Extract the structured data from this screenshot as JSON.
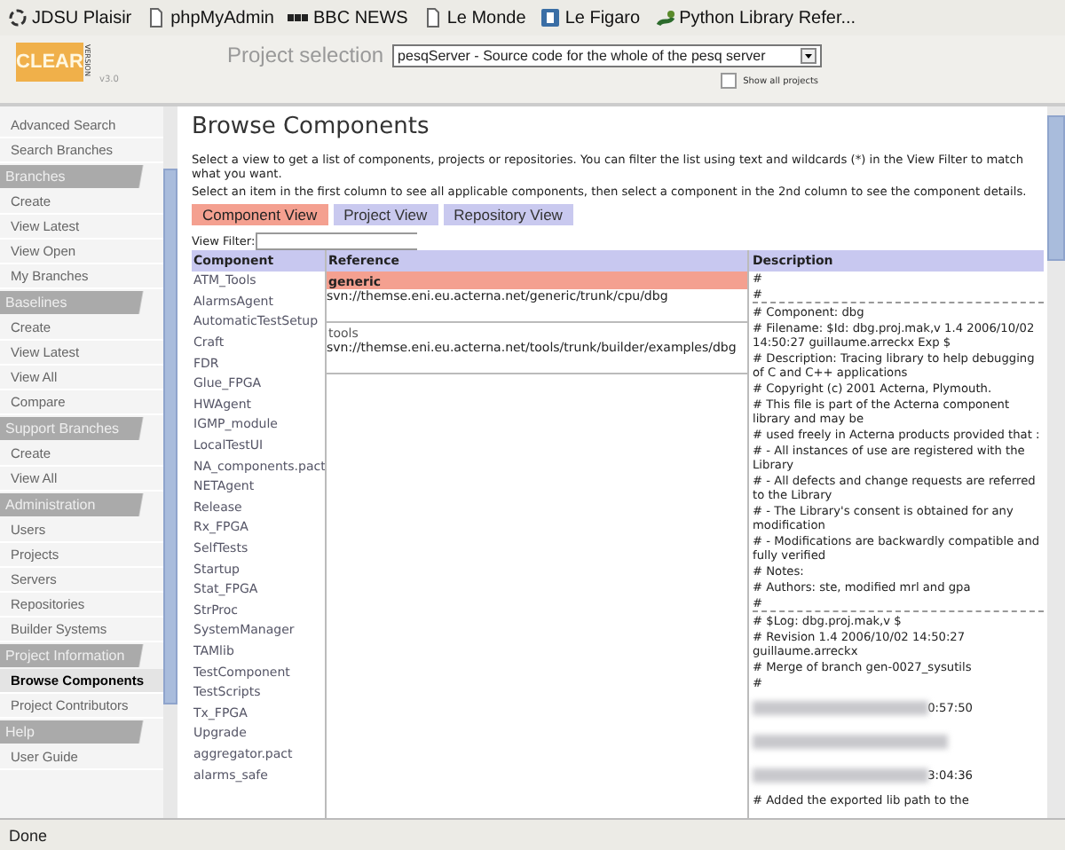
{
  "bookmarks": [
    {
      "label": "JDSU Plaisir"
    },
    {
      "label": "phpMyAdmin"
    },
    {
      "label": "BBC NEWS"
    },
    {
      "label": "Le Monde"
    },
    {
      "label": "Le Figaro"
    },
    {
      "label": "Python Library Refer..."
    }
  ],
  "header": {
    "logo": "CLEAR",
    "logo_side": "VERSION",
    "version": "v3.0",
    "project_label": "Project selection",
    "project_value": "pesqServer - Source code for the whole of the pesq server",
    "show_all_label": "Show all projects",
    "show_all_checked": false
  },
  "sidebar": [
    {
      "items": [
        {
          "label": "Advanced Search",
          "selected": false
        },
        {
          "label": "Search Branches",
          "selected": false
        }
      ]
    },
    {
      "title": "Branches",
      "items": [
        {
          "label": "Create",
          "selected": false
        },
        {
          "label": "View Latest",
          "selected": false
        },
        {
          "label": "View Open",
          "selected": false
        },
        {
          "label": "My Branches",
          "selected": false
        }
      ]
    },
    {
      "title": "Baselines",
      "items": [
        {
          "label": "Create",
          "selected": false
        },
        {
          "label": "View Latest",
          "selected": false
        },
        {
          "label": "View All",
          "selected": false
        },
        {
          "label": "Compare",
          "selected": false
        }
      ]
    },
    {
      "title": "Support Branches",
      "items": [
        {
          "label": "Create",
          "selected": false
        },
        {
          "label": "View All",
          "selected": false
        }
      ]
    },
    {
      "title": "Administration",
      "items": [
        {
          "label": "Users",
          "selected": false
        },
        {
          "label": "Projects",
          "selected": false
        },
        {
          "label": "Servers",
          "selected": false
        },
        {
          "label": "Repositories",
          "selected": false
        },
        {
          "label": "Builder Systems",
          "selected": false
        }
      ]
    },
    {
      "title": "Project Information",
      "items": [
        {
          "label": "Browse Components",
          "selected": true
        },
        {
          "label": "Project Contributors",
          "selected": false
        }
      ]
    },
    {
      "title": "Help",
      "items": [
        {
          "label": "User Guide",
          "selected": false
        }
      ]
    }
  ],
  "page": {
    "title": "Browse Components",
    "intro": [
      "Select a view to get a list of components, projects or repositories. You can filter the list using text and wildcards (*) in the View Filter to match what you want.",
      "Select an item in the first column to see all applicable components, then select a component in the 2nd column to see the component details."
    ],
    "tabs": [
      {
        "label": "Component View",
        "selected": true
      },
      {
        "label": "Project View",
        "selected": false
      },
      {
        "label": "Repository View",
        "selected": false
      }
    ],
    "filter_label": "View Filter:",
    "columns": [
      "Component",
      "Reference",
      "Description"
    ],
    "components": [
      "ATM_Tools",
      "AlarmsAgent",
      "AutomaticTestSetup",
      "Craft",
      "FDR",
      "Glue_FPGA",
      "HWAgent",
      "IGMP_module",
      "LocalTestUI",
      "NA_components.pact",
      "NETAgent",
      "Release",
      "Rx_FPGA",
      "SelfTests",
      "Startup",
      "Stat_FPGA",
      "StrProc",
      "SystemManager",
      "TAMlib",
      "TestComponent",
      "TestScripts",
      "Tx_FPGA",
      "Upgrade",
      "aggregator.pact",
      "alarms_safe"
    ],
    "references": [
      {
        "name": "generic",
        "path": "svn://themse.eni.eu.acterna.net/generic/trunk/cpu/dbg",
        "selected": true
      },
      {
        "name": "tools",
        "path": "svn://themse.eni.eu.acterna.net/tools/trunk/builder/examples/dbg",
        "selected": false
      }
    ],
    "description": [
      {
        "kind": "text",
        "text": "#"
      },
      {
        "kind": "rule",
        "text": "#"
      },
      {
        "kind": "text",
        "text": "# Component: dbg"
      },
      {
        "kind": "text",
        "text": "# Filename: $Id: dbg.proj.mak,v 1.4 2006/10/02 14:50:27 guillaume.arreckx Exp $"
      },
      {
        "kind": "text",
        "text": "# Description: Tracing library to help debugging of C and C++ applications"
      },
      {
        "kind": "text",
        "text": "# Copyright (c) 2001 Acterna, Plymouth."
      },
      {
        "kind": "text",
        "text": "# This file is part of the Acterna component library and may be"
      },
      {
        "kind": "text",
        "text": "# used freely in Acterna products provided that :"
      },
      {
        "kind": "text",
        "text": "# - All instances of use are registered with the Library"
      },
      {
        "kind": "text",
        "text": "# - All defects and change requests are referred to the Library"
      },
      {
        "kind": "text",
        "text": "# - The Library's consent is obtained for any modification"
      },
      {
        "kind": "text",
        "text": "# - Modifications are backwardly compatible and fully verified"
      },
      {
        "kind": "text",
        "text": "# Notes:"
      },
      {
        "kind": "text",
        "text": "# Authors: ste, modified mrl and gpa"
      },
      {
        "kind": "rule",
        "text": "#"
      },
      {
        "kind": "text",
        "text": "# $Log: dbg.proj.mak,v $"
      },
      {
        "kind": "text",
        "text": "# Revision 1.4 2006/10/02 14:50:27 guillaume.arreckx"
      },
      {
        "kind": "text",
        "text": "# Merge of branch gen-0027_sysutils"
      },
      {
        "kind": "text",
        "text": "#"
      },
      {
        "kind": "blur",
        "text": "0:57:50"
      },
      {
        "kind": "blur"
      },
      {
        "kind": "blur",
        "text": "3:04:36"
      },
      {
        "kind": "text",
        "text": "# Added the exported lib path to the"
      }
    ]
  },
  "status": "Done"
}
